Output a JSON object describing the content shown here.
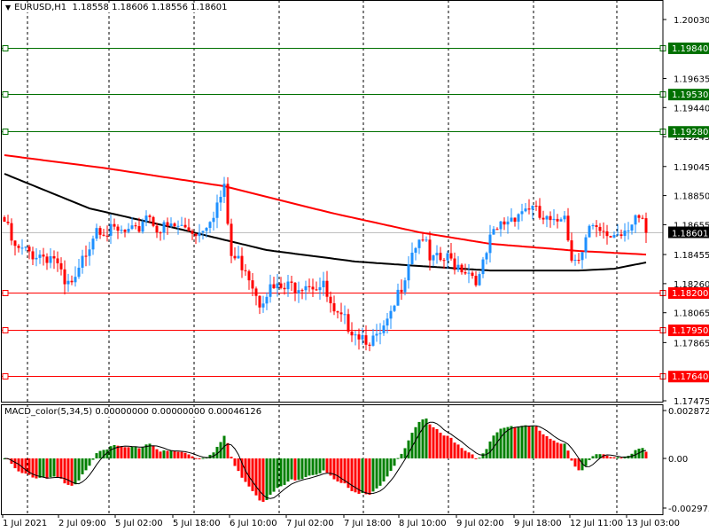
{
  "header": {
    "symbol": "EURUSD,H1",
    "open": "1.18558",
    "high": "1.18606",
    "low": "1.18556",
    "close": "1.18601"
  },
  "macd_header": {
    "name": "MACD_color(5,34,5)",
    "v1": "0.00000000",
    "v2": "0.00000000",
    "v3": "0.00046126"
  },
  "colors": {
    "bull": "#1e90ff",
    "bear": "#ff0000",
    "ma_slow": "#ff0000",
    "ma_fast": "#000000",
    "level_green": "#007000",
    "level_red": "#ff0000",
    "hist_up": "#008000",
    "hist_down": "#ff0000"
  },
  "chart_data": {
    "type": "candlestick",
    "symbol": "EURUSD",
    "timeframe": "H1",
    "ylim": [
      1.17475,
      1.2003
    ],
    "price_ticks": [
      "1.20030",
      "1.19635",
      "1.19440",
      "1.19245",
      "1.19045",
      "1.18850",
      "1.18655",
      "1.18455",
      "1.18260",
      "1.18065",
      "1.17865",
      "1.17475"
    ],
    "current_price": "1.18601",
    "levels": [
      {
        "price": "1.19840",
        "color": "green"
      },
      {
        "price": "1.19530",
        "color": "green"
      },
      {
        "price": "1.19280",
        "color": "green"
      },
      {
        "price": "1.18200",
        "color": "red"
      },
      {
        "price": "1.17950",
        "color": "red"
      },
      {
        "price": "1.17640",
        "color": "red"
      }
    ],
    "bar_count": 182,
    "close_anchors": [
      [
        0,
        1.18675
      ],
      [
        3,
        1.1848
      ],
      [
        9,
        1.1846
      ],
      [
        14,
        1.1844
      ],
      [
        17,
        1.1823
      ],
      [
        20,
        1.1826
      ],
      [
        23,
        1.1848
      ],
      [
        26,
        1.18663
      ],
      [
        30,
        1.186
      ],
      [
        37,
        1.1859
      ],
      [
        40,
        1.1874
      ],
      [
        44,
        1.1862
      ],
      [
        49,
        1.1864
      ],
      [
        55,
        1.1861
      ],
      [
        59,
        1.1875
      ],
      [
        62,
        1.1888
      ],
      [
        64,
        1.1844
      ],
      [
        68,
        1.1838
      ],
      [
        72,
        1.1815
      ],
      [
        74,
        1.1822
      ],
      [
        79,
        1.1822
      ],
      [
        85,
        1.1828
      ],
      [
        90,
        1.1823
      ],
      [
        93,
        1.1803
      ],
      [
        97,
        1.1799
      ],
      [
        100,
        1.1793
      ],
      [
        105,
        1.1787
      ],
      [
        109,
        1.1802
      ],
      [
        112,
        1.1826
      ],
      [
        115,
        1.185
      ],
      [
        118,
        1.1859
      ],
      [
        120,
        1.184
      ],
      [
        125,
        1.1842
      ],
      [
        129,
        1.1838
      ],
      [
        134,
        1.1829
      ],
      [
        137,
        1.1854
      ],
      [
        140,
        1.1865
      ],
      [
        144,
        1.1873
      ],
      [
        148,
        1.1878
      ],
      [
        151,
        1.187
      ],
      [
        155,
        1.1864
      ],
      [
        158,
        1.1876
      ],
      [
        160,
        1.1842
      ],
      [
        163,
        1.185
      ],
      [
        165,
        1.1862
      ],
      [
        169,
        1.1857
      ],
      [
        174,
        1.1861
      ],
      [
        178,
        1.1872
      ],
      [
        180,
        1.1864
      ],
      [
        181,
        1.18601
      ]
    ],
    "ma_slow_anchors": [
      [
        0,
        1.19121
      ],
      [
        29,
        1.19032
      ],
      [
        62,
        1.18913
      ],
      [
        92,
        1.18735
      ],
      [
        117,
        1.18604
      ],
      [
        137,
        1.18527
      ],
      [
        162,
        1.18479
      ],
      [
        181,
        1.18455
      ]
    ],
    "ma_fast_anchors": [
      [
        0,
        1.18996
      ],
      [
        24,
        1.18764
      ],
      [
        49,
        1.18628
      ],
      [
        74,
        1.18485
      ],
      [
        99,
        1.18408
      ],
      [
        117,
        1.18378
      ],
      [
        137,
        1.18348
      ],
      [
        162,
        1.18348
      ],
      [
        172,
        1.1836
      ],
      [
        181,
        1.18402
      ]
    ],
    "macd": {
      "params": [
        5,
        34,
        5
      ],
      "ylim": [
        -0.002975,
        0.0028725
      ],
      "ticks": [
        "0.0028725",
        "0.00",
        "-0.002975"
      ]
    },
    "time_labels": [
      "1 Jul 2021",
      "2 Jul 09:00",
      "5 Jul 02:00",
      "5 Jul 18:00",
      "6 Jul 10:00",
      "7 Jul 02:00",
      "7 Jul 18:00",
      "8 Jul 10:00",
      "9 Jul 02:00",
      "9 Jul 18:00",
      "12 Jul 11:00",
      "13 Jul 03:00"
    ]
  }
}
